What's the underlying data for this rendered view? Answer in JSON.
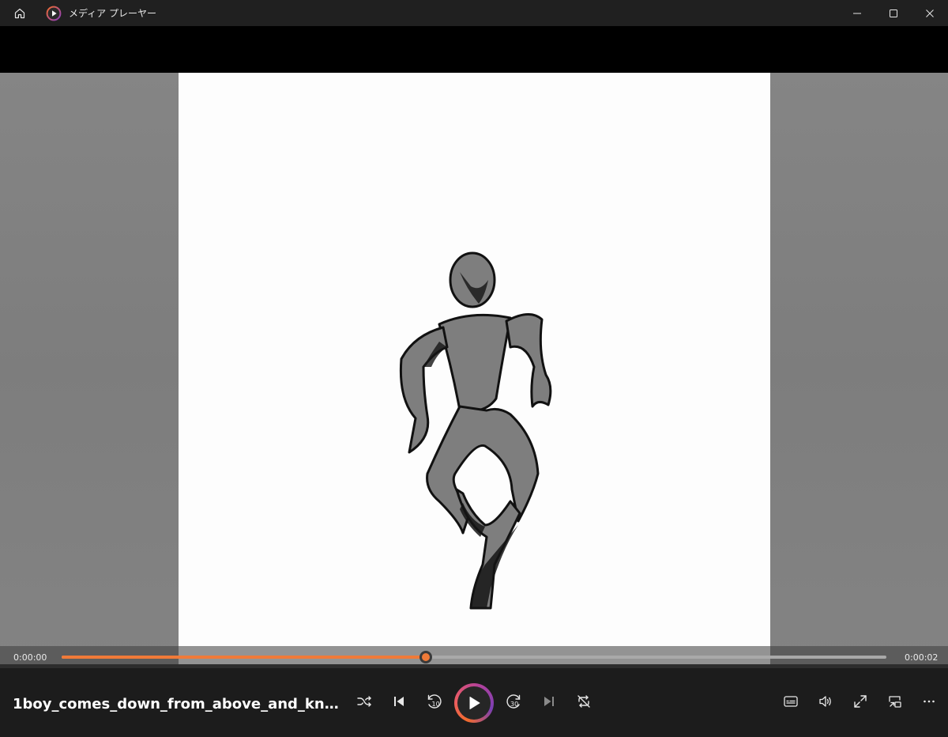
{
  "window": {
    "title": "メディア プレーヤー"
  },
  "playback": {
    "current_time": "0:00:00",
    "duration": "0:00:02",
    "progress": 0.442
  },
  "now_playing": {
    "title": "1boy_comes_down_from_above_and_kneels..."
  },
  "icons": {
    "home": "home-icon",
    "app": "media-player-logo",
    "minimize": "minimize-icon",
    "maximize": "maximize-icon",
    "close": "close-icon",
    "shuffle": "shuffle-icon",
    "previous": "previous-icon",
    "rewind": "rewind-10-icon",
    "play": "play-icon",
    "forward": "forward-30-icon",
    "next": "next-icon",
    "repeat": "repeat-icon",
    "captions": "captions-icon",
    "volume": "volume-icon",
    "fullscreen": "fullscreen-icon",
    "miniplayer": "miniplayer-icon",
    "more": "more-icon"
  },
  "colors": {
    "accent": "#f07a38",
    "titlebar": "#202020",
    "controls_bg": "#1c1c1c"
  }
}
